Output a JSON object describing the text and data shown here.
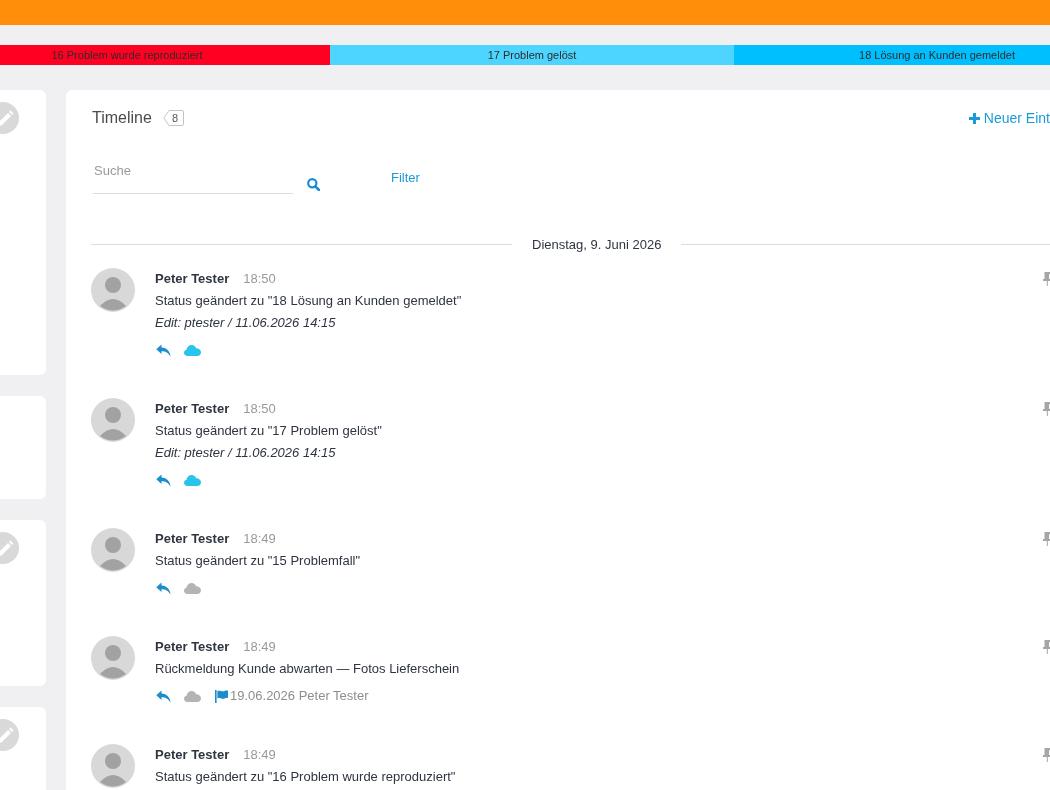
{
  "status_steps": [
    {
      "label": "16 Problem wurde reproduziert",
      "color": "#ff0022"
    },
    {
      "label": "17 Problem gelöst",
      "color": "#4dd5ff"
    },
    {
      "label": "18 Lösung an Kunden gemeldet",
      "color": "#00bfff"
    }
  ],
  "side_cards": [
    {
      "edit_button": true
    },
    {
      "edit_button": false
    },
    {
      "edit_button": true
    },
    {
      "edit_button": true
    }
  ],
  "timeline": {
    "title": "Timeline",
    "count": "8",
    "new_entry": "Neuer Eint",
    "search": {
      "placeholder": "Suche"
    },
    "filter": "Filter",
    "date": "Dienstag, 9. Juni 2026",
    "entries": [
      {
        "author": "Peter Tester",
        "time": "18:50",
        "text": "Status geändert zu \"18 Lösung an Kunden gemeldet\"",
        "edit": "Edit: ptester / 11.06.2026 14:15",
        "actions": {
          "cloud_on": true
        }
      },
      {
        "author": "Peter Tester",
        "time": "18:50",
        "text": "Status geändert zu \"17 Problem gelöst\"",
        "edit": "Edit: ptester / 11.06.2026 14:15",
        "actions": {
          "cloud_on": true
        }
      },
      {
        "author": "Peter Tester",
        "time": "18:49",
        "text": "Status geändert zu \"15 Problemfall\"",
        "actions": {
          "cloud_on": false
        }
      },
      {
        "author": "Peter Tester",
        "time": "18:49",
        "text": "Rückmeldung Kunde abwarten — Fotos Lieferschein",
        "actions": {
          "cloud_on": false,
          "flag": "19.06.2026 Peter Tester"
        }
      },
      {
        "author": "Peter Tester",
        "time": "18:49",
        "text": "Status geändert zu \"16 Problem wurde reproduziert\""
      }
    ]
  }
}
